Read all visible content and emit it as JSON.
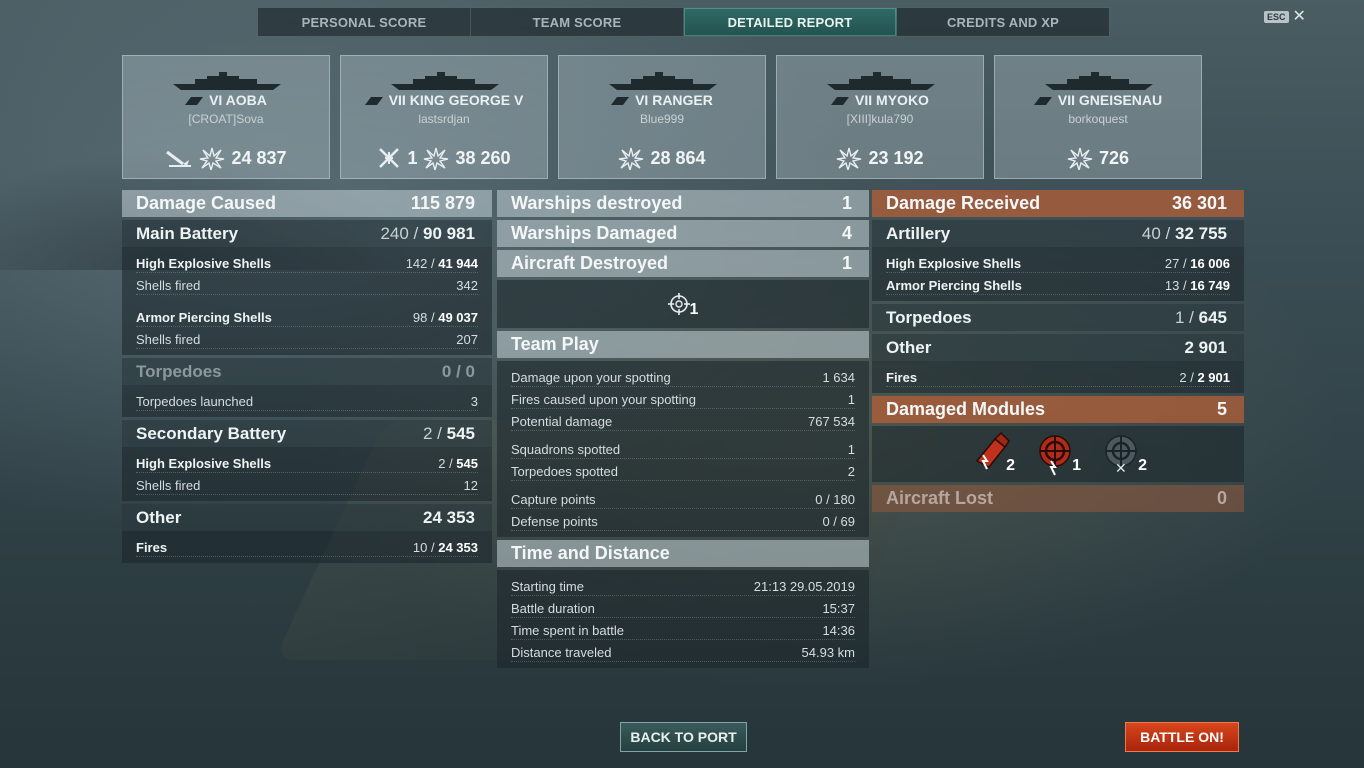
{
  "tabs": [
    {
      "label": "PERSONAL SCORE",
      "active": false
    },
    {
      "label": "TEAM SCORE",
      "active": false
    },
    {
      "label": "DETAILED REPORT",
      "active": true
    },
    {
      "label": "CREDITS AND XP",
      "active": false
    }
  ],
  "esc_label": "ESC",
  "ships": [
    {
      "tier_name": "VI AOBA",
      "player": "[CROAT]Sova",
      "secondary_icon": "torpedo-hit-icon",
      "secondary_value": "",
      "damage": "24 837"
    },
    {
      "tier_name": "VII KING GEORGE V",
      "player": "lastsrdjan",
      "secondary_icon": "aircraft-shot-down-icon",
      "secondary_value": "1",
      "damage": "38 260"
    },
    {
      "tier_name": "VI RANGER",
      "player": "Blue999",
      "secondary_icon": "",
      "secondary_value": "",
      "damage": "28 864"
    },
    {
      "tier_name": "VII MYOKO",
      "player": "[XIII]kula790",
      "secondary_icon": "",
      "secondary_value": "",
      "damage": "23 192"
    },
    {
      "tier_name": "VII GNEISENAU",
      "player": "borkoquest",
      "secondary_icon": "",
      "secondary_value": "",
      "damage": "726"
    }
  ],
  "left": {
    "damage_caused": {
      "label": "Damage Caused",
      "value": "115 879"
    },
    "main_battery": {
      "label": "Main Battery",
      "hits": "240",
      "value": "90 981"
    },
    "mb_he": {
      "label": "High Explosive Shells",
      "hits": "142",
      "value": "41 944"
    },
    "mb_he_fired": {
      "label": "Shells fired",
      "value": "342"
    },
    "mb_ap": {
      "label": "Armor Piercing Shells",
      "hits": "98",
      "value": "49 037"
    },
    "mb_ap_fired": {
      "label": "Shells fired",
      "value": "207"
    },
    "torpedoes": {
      "label": "Torpedoes",
      "hits": "0",
      "value": "0"
    },
    "torp_launched": {
      "label": "Torpedoes launched",
      "value": "3"
    },
    "secondary": {
      "label": "Secondary Battery",
      "hits": "2",
      "value": "545"
    },
    "sec_he": {
      "label": "High Explosive Shells",
      "hits": "2",
      "value": "545"
    },
    "sec_fired": {
      "label": "Shells fired",
      "value": "12"
    },
    "other": {
      "label": "Other",
      "value": "24 353"
    },
    "fires": {
      "label": "Fires",
      "hits": "10",
      "value": "24 353"
    }
  },
  "mid": {
    "destroyed": {
      "label": "Warships destroyed",
      "value": "1"
    },
    "damaged": {
      "label": "Warships Damaged",
      "value": "4"
    },
    "aircraft": {
      "label": "Aircraft Destroyed",
      "value": "1"
    },
    "aircraft_icon_count": "1",
    "team_play": {
      "label": "Team Play"
    },
    "spot_dmg": {
      "label": "Damage upon your spotting",
      "value": "1 634"
    },
    "spot_fires": {
      "label": "Fires caused upon your spotting",
      "value": "1"
    },
    "potential": {
      "label": "Potential damage",
      "value": "767 534"
    },
    "squadrons": {
      "label": "Squadrons spotted",
      "value": "1"
    },
    "torp_spotted": {
      "label": "Torpedoes spotted",
      "value": "2"
    },
    "capture": {
      "label": "Capture points",
      "value": "0 / 180"
    },
    "defense": {
      "label": "Defense points",
      "value": "0 / 69"
    },
    "time_dist": {
      "label": "Time and Distance"
    },
    "start": {
      "label": "Starting time",
      "value": "21:13  29.05.2019"
    },
    "duration": {
      "label": "Battle duration",
      "value": "15:37"
    },
    "time_spent": {
      "label": "Time spent in battle",
      "value": "14:36"
    },
    "distance": {
      "label": "Distance traveled",
      "value": "54.93 km"
    }
  },
  "right": {
    "received": {
      "label": "Damage Received",
      "value": "36 301"
    },
    "artillery": {
      "label": "Artillery",
      "hits": "40",
      "value": "32 755"
    },
    "art_he": {
      "label": "High Explosive Shells",
      "hits": "27",
      "value": "16 006"
    },
    "art_ap": {
      "label": "Armor Piercing Shells",
      "hits": "13",
      "value": "16 749"
    },
    "torpedoes": {
      "label": "Torpedoes",
      "hits": "1",
      "value": "645"
    },
    "other": {
      "label": "Other",
      "value": "2 901"
    },
    "fires": {
      "label": "Fires",
      "hits": "2",
      "value": "2 901"
    },
    "modules": {
      "label": "Damaged Modules",
      "value": "5"
    },
    "modules_list": [
      {
        "icon": "turret-damaged-icon",
        "count": "2"
      },
      {
        "icon": "steering-damaged-icon",
        "count": "1"
      },
      {
        "icon": "torpedo-tube-destroyed-icon",
        "count": "2"
      }
    ],
    "aircraft_lost": {
      "label": "Aircraft Lost",
      "value": "0"
    }
  },
  "buttons": {
    "back": "BACK TO PORT",
    "battle": "BATTLE ON!"
  },
  "colors": {
    "accent_orange": "#b45f37",
    "tab_active": "#2f6a66",
    "battle_button": "#d8461c"
  }
}
